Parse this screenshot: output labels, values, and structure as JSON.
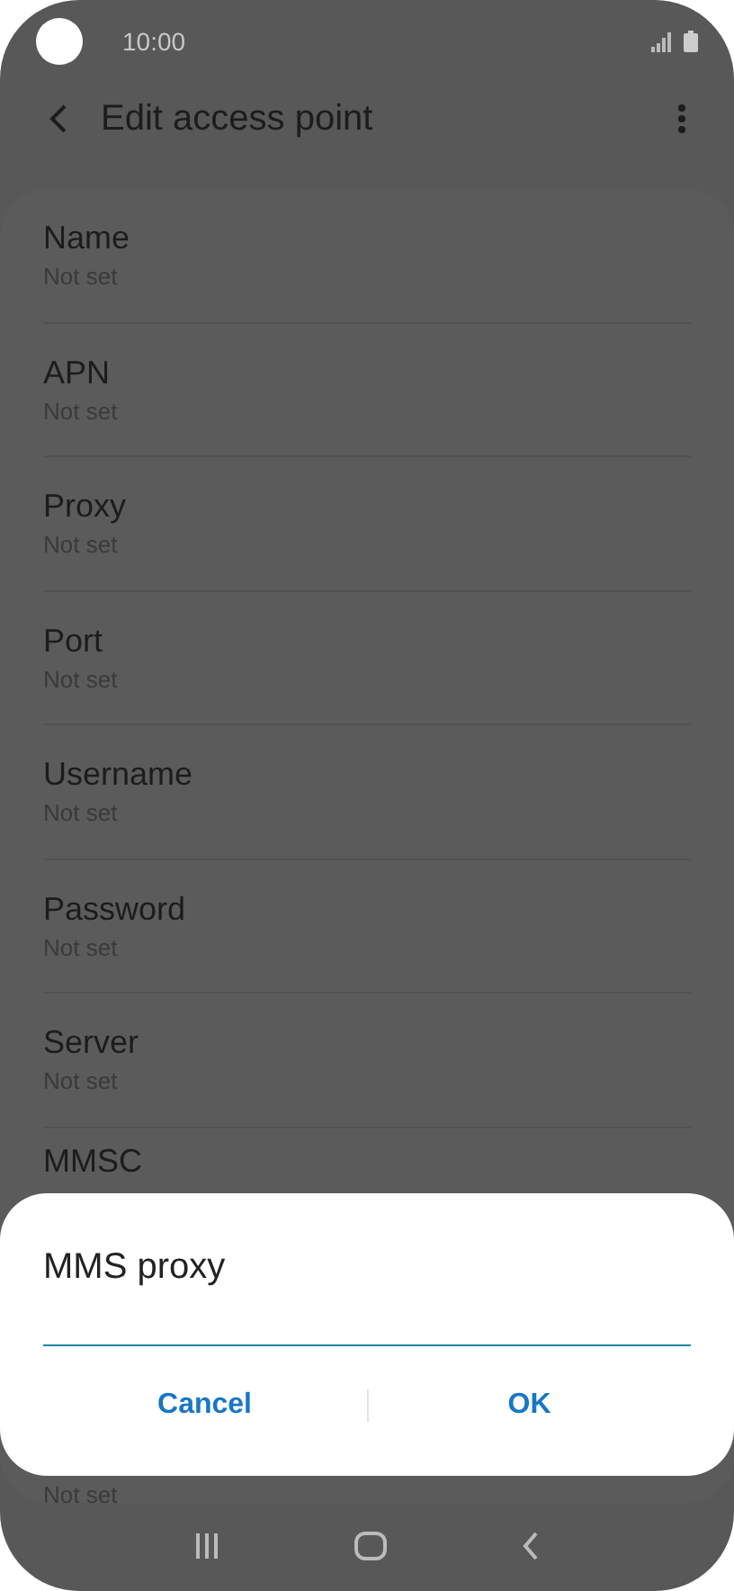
{
  "status_bar": {
    "time": "10:00"
  },
  "app_bar": {
    "title": "Edit access point"
  },
  "items": [
    {
      "title": "Name",
      "subtitle": "Not set"
    },
    {
      "title": "APN",
      "subtitle": "Not set"
    },
    {
      "title": "Proxy",
      "subtitle": "Not set"
    },
    {
      "title": "Port",
      "subtitle": "Not set"
    },
    {
      "title": "Username",
      "subtitle": "Not set"
    },
    {
      "title": "Password",
      "subtitle": "Not set"
    },
    {
      "title": "Server",
      "subtitle": "Not set"
    },
    {
      "title": "MMSC"
    },
    {
      "subtitle": "Not set"
    }
  ],
  "dialog": {
    "title": "MMS proxy",
    "buttons": [
      "Cancel",
      "OK"
    ]
  }
}
